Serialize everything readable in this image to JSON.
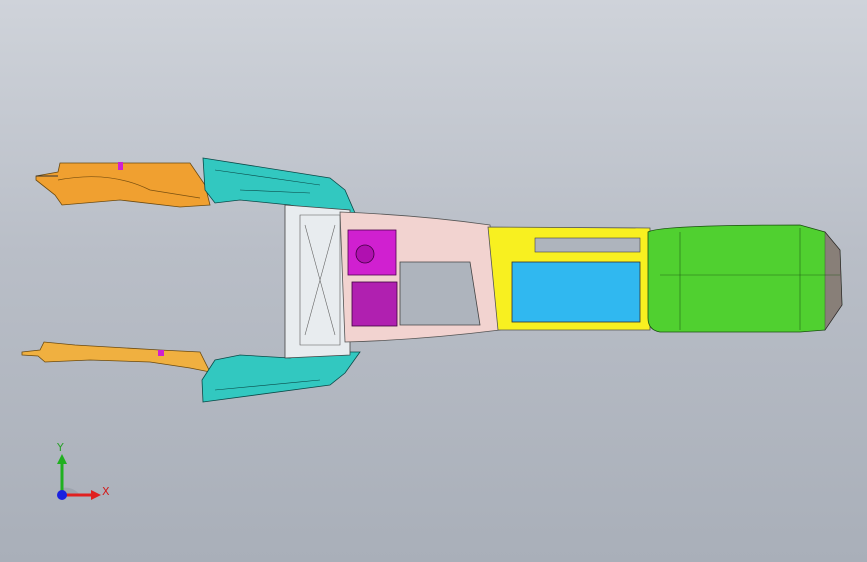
{
  "triad": {
    "x_label": "X",
    "y_label": "Y",
    "x_color": "#e02020",
    "y_color": "#20b020",
    "z_color": "#1a20e0"
  },
  "model_colors": {
    "teal": "#32c8c0",
    "orange": "#f0a030",
    "magenta": "#d020d0",
    "yellow": "#f8f020",
    "cyan": "#30b8f0",
    "green": "#50d030",
    "pink": "#f2d3d0"
  }
}
